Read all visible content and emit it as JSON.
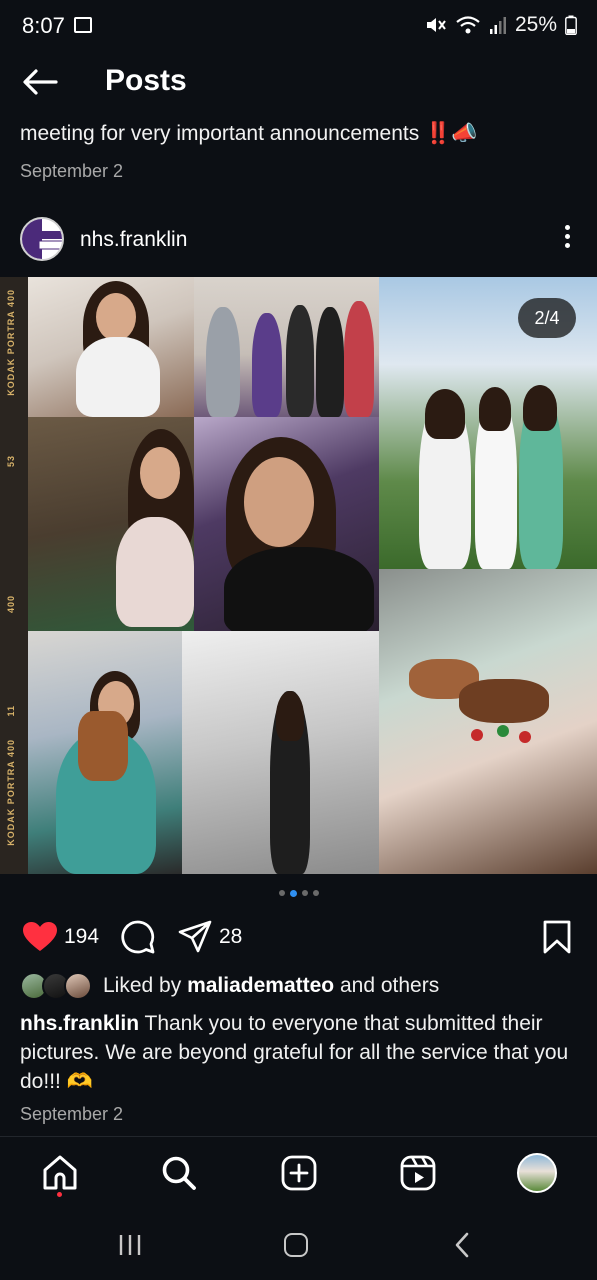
{
  "status_bar": {
    "time": "8:07",
    "battery": "25%"
  },
  "header": {
    "title": "Posts"
  },
  "previous_post": {
    "caption": "meeting for very important announcements ‼️📣",
    "date": "September 2"
  },
  "post": {
    "username": "nhs.franklin",
    "slide_indicator": "2/4",
    "slide_total": 4,
    "slide_current": 2,
    "film_labels": [
      "KODAK PORTRA 400",
      "53",
      "400",
      "11",
      "KODAK PORTRA 400"
    ],
    "like_count": "194",
    "share_count": "28",
    "liked_by_prefix": "Liked by ",
    "liked_by_user": "maliadematteo",
    "liked_by_suffix": " and others",
    "caption_user": "nhs.franklin",
    "caption_text": " Thank you to everyone that submitted their pictures. We are beyond grateful for all the service that you do!!! 🫶",
    "date": "September 2",
    "avatar_text": "FHS NHS"
  },
  "bottom_nav": {
    "items": [
      "home-icon",
      "search-icon",
      "create-icon",
      "reels-icon",
      "profile-avatar"
    ]
  },
  "colors": {
    "background": "#0c0f14",
    "like": "#ff3040",
    "active_dot": "#2f8ff0",
    "school_purple": "#4b2a7a"
  }
}
